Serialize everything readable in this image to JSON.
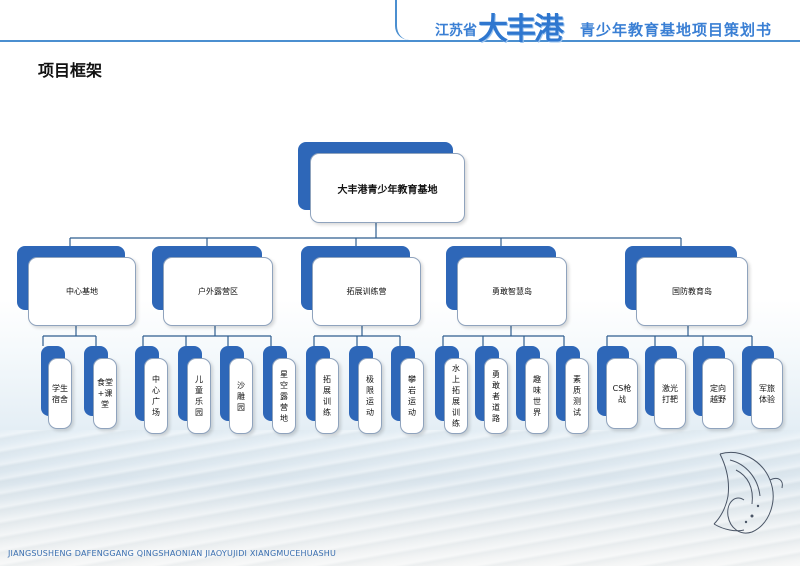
{
  "header": {
    "province": "江苏省",
    "brand": "大丰港",
    "subtitle": "青少年教育基地项目策划书"
  },
  "page_title": "项目框架",
  "root": {
    "label": "大丰港青少年教育基地"
  },
  "categories": [
    {
      "label": "中心基地",
      "children": [
        "学生\n宿舍",
        "食堂\n+课\n堂"
      ]
    },
    {
      "label": "户外露营区",
      "children": [
        "中\n心\n广\n场",
        "儿\n童\n乐\n园",
        "沙\n雕\n园",
        "星\n空\n露\n营\n地"
      ]
    },
    {
      "label": "拓展训练营",
      "children": [
        "拓\n展\n训\n练",
        "极\n限\n运\n动",
        "攀\n岩\n运\n动"
      ]
    },
    {
      "label": "勇敢智慧岛",
      "children": [
        "水\n上\n拓\n展\n训\n练",
        "勇\n敢\n者\n道\n路",
        "趣\n味\n世\n界",
        "素\n质\n测\n试"
      ]
    },
    {
      "label": "国防教育岛",
      "children": [
        "CS枪\n战",
        "激光\n打靶",
        "定向\n越野",
        "军旅\n体验"
      ]
    }
  ],
  "footer": "JIANGSUSHENG DAFENGGANG QINGSHAONIAN JIAOYUJIDI XIANGMUCEHUASHU",
  "colors": {
    "accent": "#2e67b8",
    "header_blue": "#3a7fd4",
    "line": "#2f5e8f"
  }
}
